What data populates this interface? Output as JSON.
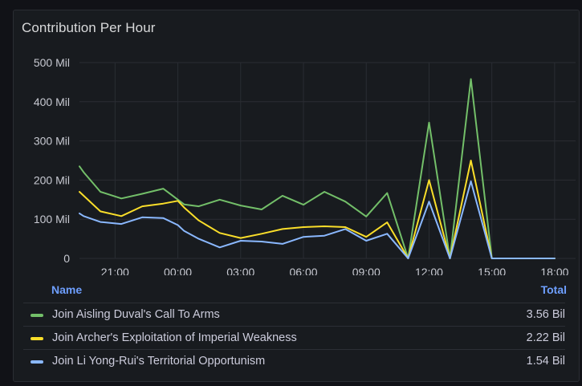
{
  "panel": {
    "title": "Contribution Per Hour"
  },
  "legend": {
    "name_header": "Name",
    "total_header": "Total",
    "rows": [
      {
        "name": "Join Aisling Duval's Call To Arms",
        "total": "3.56 Bil",
        "color": "#73bf69"
      },
      {
        "name": "Join Archer's Exploitation of Imperial Weakness",
        "total": "2.22 Bil",
        "color": "#fade2a"
      },
      {
        "name": "Join Li Yong-Rui's Territorial Opportunism",
        "total": "1.54 Bil",
        "color": "#8ab8ff"
      }
    ]
  },
  "chart_data": {
    "type": "line",
    "y_ticks": [
      "0",
      "100 Mil",
      "200 Mil",
      "300 Mil",
      "400 Mil",
      "500 Mil"
    ],
    "y_tick_values": [
      0,
      100,
      200,
      300,
      400,
      500
    ],
    "x_ticks": [
      "21:00",
      "00:00",
      "03:00",
      "06:00",
      "09:00",
      "12:00",
      "15:00",
      "18:00"
    ],
    "x_tick_hours": [
      21,
      24,
      27,
      30,
      33,
      36,
      39,
      42
    ],
    "y_unit": "Mil",
    "ylim": [
      0,
      500
    ],
    "xlim_hours": [
      19.3,
      43
    ],
    "grid": true,
    "x_hours": [
      19.3,
      19.5,
      20.3,
      21.3,
      22.3,
      23.3,
      24.0,
      24.3,
      25.0,
      26.0,
      27.0,
      28.0,
      29.0,
      30.0,
      31.0,
      32.0,
      33.0,
      34.0,
      35.0,
      36.0,
      37.0,
      38.0,
      39.0,
      40.0,
      41.0,
      42.0
    ],
    "series": [
      {
        "name": "Join Aisling Duval's Call To Arms",
        "color": "#73bf69",
        "values": [
          235,
          220,
          170,
          153,
          165,
          178,
          150,
          138,
          133,
          150,
          135,
          125,
          160,
          137,
          170,
          145,
          107,
          167,
          0,
          347,
          0,
          458,
          0,
          0,
          0,
          0
        ]
      },
      {
        "name": "Join Archer's Exploitation of Imperial Weakness",
        "color": "#fade2a",
        "values": [
          170,
          160,
          120,
          108,
          133,
          140,
          147,
          130,
          97,
          65,
          52,
          63,
          75,
          80,
          82,
          80,
          55,
          92,
          0,
          200,
          0,
          250,
          0,
          0,
          0,
          0
        ]
      },
      {
        "name": "Join Li Yong-Rui's Territorial Opportunism",
        "color": "#8ab8ff",
        "values": [
          115,
          108,
          93,
          88,
          105,
          103,
          85,
          70,
          50,
          28,
          45,
          43,
          37,
          55,
          58,
          75,
          45,
          63,
          0,
          145,
          0,
          197,
          0,
          0,
          0,
          0
        ]
      }
    ]
  }
}
